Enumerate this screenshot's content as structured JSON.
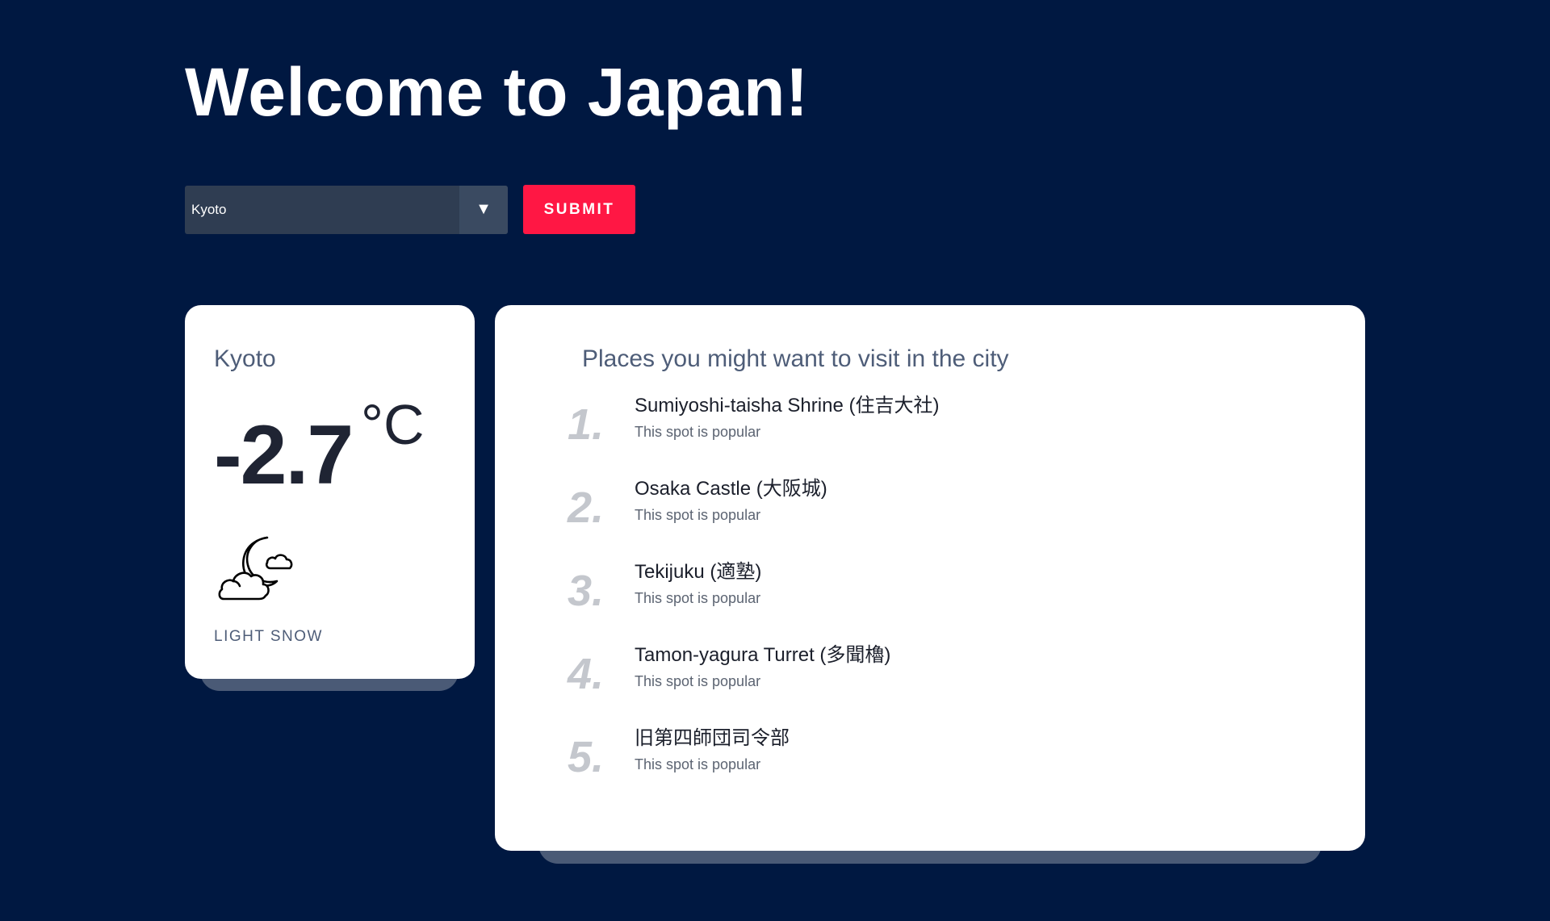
{
  "header": {
    "title": "Welcome to Japan!"
  },
  "search": {
    "selected_city": "Kyoto",
    "submit_label": "SUBMIT"
  },
  "weather": {
    "city": "Kyoto",
    "temperature": "-2.7",
    "unit": "°C",
    "condition": "LIGHT SNOW",
    "icon": "night-cloudy-icon"
  },
  "places": {
    "title": "Places you might want to visit in the city",
    "items": [
      {
        "rank": "1.",
        "name": "Sumiyoshi-taisha Shrine (住吉大社)",
        "note": "This spot is popular"
      },
      {
        "rank": "2.",
        "name": "Osaka Castle (大阪城)",
        "note": "This spot is popular"
      },
      {
        "rank": "3.",
        "name": "Tekijuku (適塾)",
        "note": "This spot is popular"
      },
      {
        "rank": "4.",
        "name": "Tamon-yagura Turret (多聞櫓)",
        "note": "This spot is popular"
      },
      {
        "rank": "5.",
        "name": "旧第四師団司令部",
        "note": "This spot is popular"
      }
    ]
  },
  "colors": {
    "background": "#001841",
    "accent": "#ff1744",
    "card": "#ffffff",
    "select_bg": "#2f3d52"
  }
}
